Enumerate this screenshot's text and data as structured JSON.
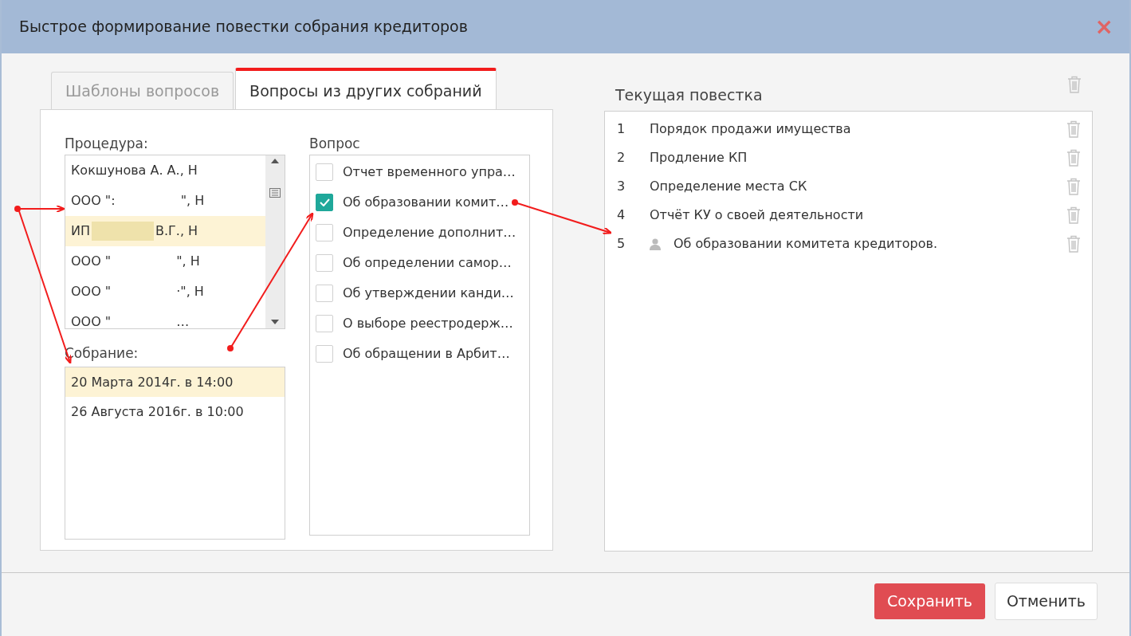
{
  "window": {
    "title": "Быстрое формирование повестки собрания кредиторов",
    "close": "×"
  },
  "tabs": [
    {
      "label": "Шаблоны вопросов",
      "selected": false
    },
    {
      "label": "Вопросы из других собраний",
      "selected": true
    }
  ],
  "procedure": {
    "label": "Процедура:",
    "items": [
      {
        "before": "Кокшунова А. А., Н",
        "selected": false
      },
      {
        "before": "ООО \":",
        "after": "\", Н",
        "selected": false
      },
      {
        "before": "ИП",
        "after": "В.Г., Н",
        "selected": true
      },
      {
        "before": "ООО \"",
        "after": "\", Н",
        "selected": false
      },
      {
        "before": "ООО \"",
        "after": "·\", Н",
        "selected": false
      },
      {
        "before": "ООО \"",
        "after": "…",
        "selected": false
      }
    ]
  },
  "meeting": {
    "label": "Собрание:",
    "items": [
      {
        "text": "20 Марта 2014г. в 14:00",
        "selected": true
      },
      {
        "text": "26 Августа 2016г. в 10:00",
        "selected": false
      }
    ]
  },
  "question": {
    "label": "Вопрос",
    "items": [
      {
        "text": "Отчет временного упра…",
        "checked": false
      },
      {
        "text": "Об образовании комит…",
        "checked": true
      },
      {
        "text": "Определение дополнит…",
        "checked": false
      },
      {
        "text": "Об определении самор…",
        "checked": false
      },
      {
        "text": "Об утверждении канди…",
        "checked": false
      },
      {
        "text": "О выборе реестродерж…",
        "checked": false
      },
      {
        "text": "Об обращении в Арбит…",
        "checked": false
      }
    ]
  },
  "agenda": {
    "title": "Текущая повестка",
    "items": [
      {
        "number": "1",
        "text": "Порядок продажи имущества",
        "kind": "plain"
      },
      {
        "number": "2",
        "text": "Продление КП",
        "kind": "plain"
      },
      {
        "number": "3",
        "text": "Определение места СК",
        "kind": "plain"
      },
      {
        "number": "4",
        "text": "Отчёт КУ о своей деятельности",
        "kind": "plain"
      },
      {
        "number": "5",
        "text": "Об образовании комитета кредиторов.",
        "kind": "from-meeting"
      }
    ]
  },
  "buttons": [
    {
      "label": "Сохранить",
      "kind": "primary"
    },
    {
      "label": "Отменить",
      "kind": "secondary"
    }
  ]
}
